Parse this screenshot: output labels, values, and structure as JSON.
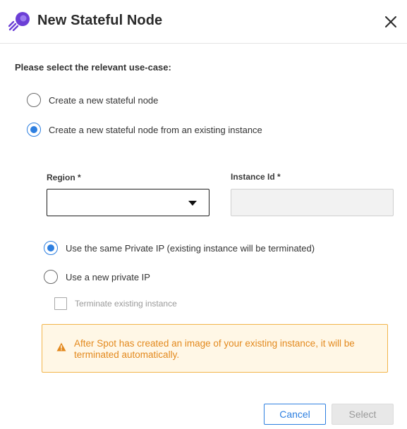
{
  "dialog": {
    "title": "New Stateful Node",
    "icon": "spot-rocket-logo",
    "close_icon": "close-icon"
  },
  "use_case": {
    "label": "Please select the relevant use-case:",
    "options": [
      {
        "label": "Create a new stateful node",
        "checked": false
      },
      {
        "label": "Create a new stateful node from an existing instance",
        "checked": true
      }
    ]
  },
  "region": {
    "label": "Region *",
    "value": ""
  },
  "instance_id": {
    "label": "Instance Id *",
    "value": ""
  },
  "ip_options": [
    {
      "label": "Use the same Private IP (existing instance will be terminated)",
      "checked": true
    },
    {
      "label": "Use a new private IP",
      "checked": false
    }
  ],
  "terminate_checkbox": {
    "label": "Terminate existing instance",
    "checked": false,
    "disabled": true
  },
  "alert": {
    "text": "After Spot has created an image of your existing instance, it will be terminated automatically.",
    "icon": "warning-icon",
    "color": "#e3891d"
  },
  "buttons": {
    "cancel": "Cancel",
    "select": "Select"
  },
  "colors": {
    "accent": "#2d7fe0",
    "brand": "#6c3fd6",
    "warning_bg": "#fff7e6",
    "warning_border": "#f2b54a"
  }
}
